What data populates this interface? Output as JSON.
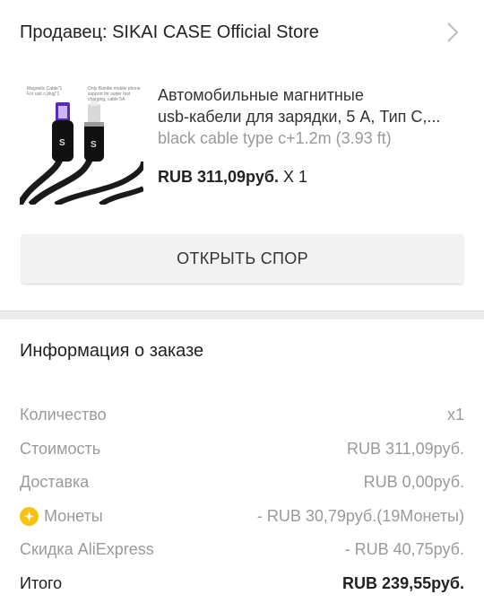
{
  "seller": {
    "label": "Продавец: SIKAI CASE Official Store"
  },
  "product": {
    "title_line1": "Автомобильные магнитные",
    "title_line2": "usb-кабели для зарядки, 5 А, Тип С,...",
    "variant": "black cable type c+1.2m (3.93 ft)",
    "price": "RUB 311,09руб.",
    "quantity": " X 1",
    "thumb_text_left": "Magnetic Cable\"1 For usb c plug\"1",
    "thumb_text_right": "Only Bundle mobile phone support for super fast charging, cable 5A"
  },
  "dispute_button": {
    "label": "ОТКРЫТЬ СПОР"
  },
  "order_info": {
    "title": "Информация о заказе",
    "rows": [
      {
        "label": "Количество",
        "value": "x1"
      },
      {
        "label": "Стоимость",
        "value": "RUB 311,09руб."
      },
      {
        "label": "Доставка",
        "value": "RUB 0,00руб."
      },
      {
        "label": "Монеты",
        "value": "- RUB 30,79руб.(19Монеты)"
      },
      {
        "label": "Скидка AliExpress",
        "value": "- RUB 40,75руб."
      },
      {
        "label": "Итого",
        "value": "RUB 239,55руб."
      }
    ]
  },
  "colors": {
    "coin": "#f6c313",
    "muted_text": "#9a9a9a",
    "divider": "#ececec"
  }
}
